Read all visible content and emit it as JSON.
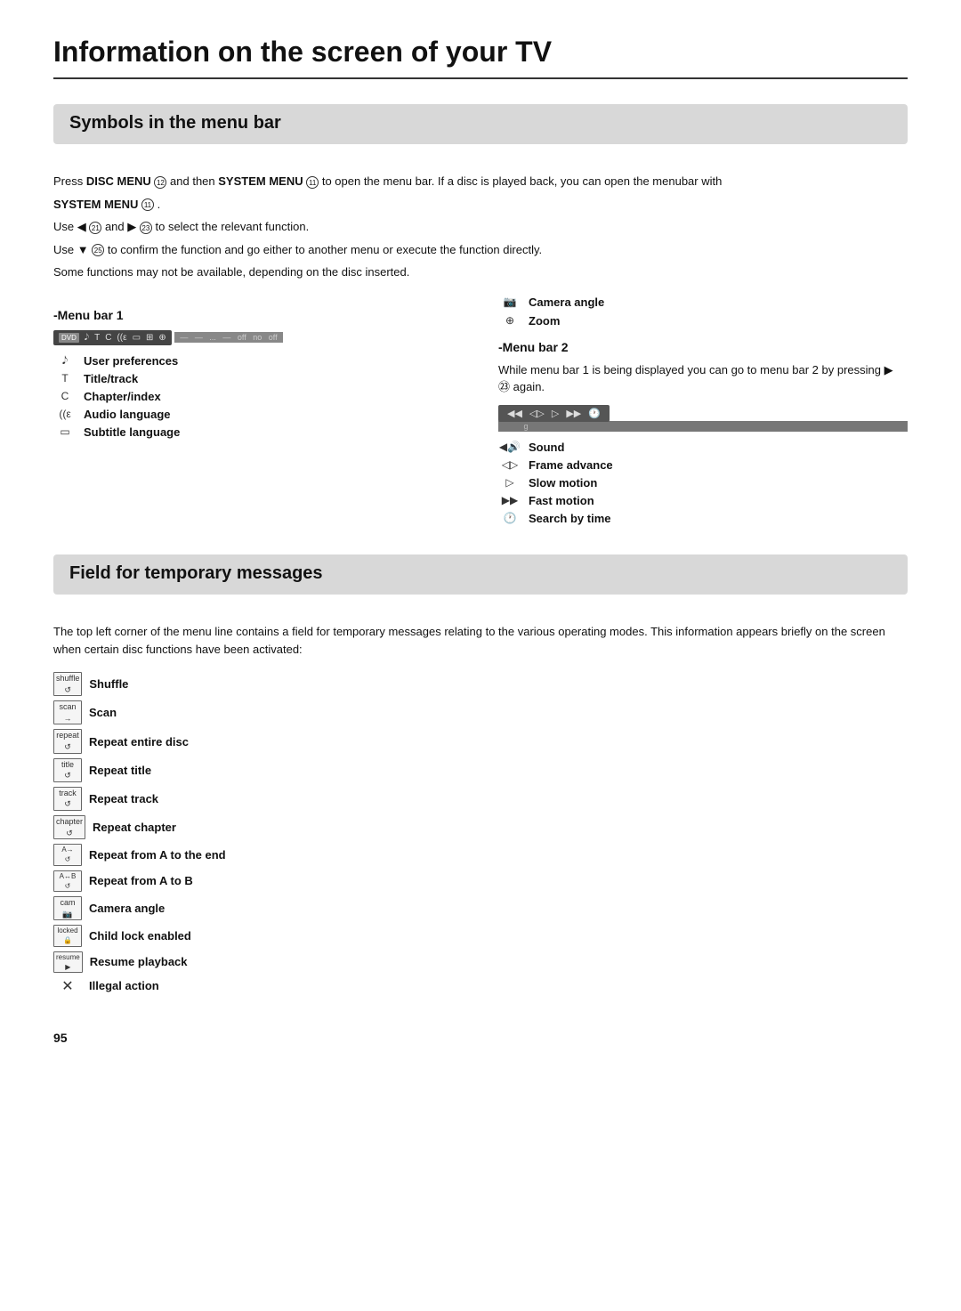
{
  "page": {
    "title": "Information on the screen of your TV",
    "page_number": "95"
  },
  "symbols_section": {
    "heading": "Symbols in the menu bar",
    "intro1": "Press  DISC MENU ⑫ and then  SYSTEM MENU ⑪ to open the menu bar. If a disc is played back, you can open the menubar with  SYSTEM MENU ⑪ .",
    "intro2": "Use ◀ ㉑ and ▶ ㉓ to select the relevant function.",
    "intro3": "Use ▼ ㉕ to confirm the function and go either to another menu or execute the function directly.",
    "intro4": "Some functions may not be available, depending on the disc inserted.",
    "menu_bar_1": {
      "heading": "-Menu bar 1",
      "items": [
        {
          "icon": "𝅘𝅥𝅮",
          "label": "User preferences",
          "sym": "TA"
        },
        {
          "icon": "T",
          "label": "Title/track",
          "sym": "T"
        },
        {
          "icon": "C",
          "label": "Chapter/index",
          "sym": "C"
        },
        {
          "icon": "((ε",
          "label": "Audio language",
          "sym": "audio"
        },
        {
          "icon": "▭",
          "label": "Subtitle language",
          "sym": "sub"
        }
      ]
    },
    "menu_bar_2": {
      "heading": "-Menu bar 2",
      "intro": "While menu bar 1 is being displayed you can go to menu bar 2 by pressing ▶ ㉓ again.",
      "items": [
        {
          "icon": "🔊",
          "label": "Sound",
          "sym": "sound"
        },
        {
          "icon": "◁▷",
          "label": "Frame advance",
          "sym": "frame"
        },
        {
          "icon": "▷",
          "label": "Slow motion",
          "sym": "slow"
        },
        {
          "icon": "▶▶",
          "label": "Fast motion",
          "sym": "fast"
        },
        {
          "icon": "🕐",
          "label": "Search by time",
          "sym": "time"
        }
      ]
    },
    "camera_angle_label": "Camera angle",
    "zoom_label": "Zoom"
  },
  "field_section": {
    "heading": "Field for temporary messages",
    "intro": "The top left corner of the menu line contains a field for temporary messages relating to the various operating modes. This information appears briefly on the screen when certain disc functions have been activated:",
    "items": [
      {
        "badge": "shuffle",
        "label": "Shuffle"
      },
      {
        "badge": "scan",
        "label": "Scan"
      },
      {
        "badge": "repeat",
        "label": "Repeat entire disc"
      },
      {
        "badge": "title",
        "label": "Repeat title"
      },
      {
        "badge": "track",
        "label": "Repeat track"
      },
      {
        "badge": "chapter",
        "label": "Repeat chapter"
      },
      {
        "badge": "A→",
        "label": "Repeat from A to the end"
      },
      {
        "badge": "A↔B",
        "label": "Repeat from A to B"
      },
      {
        "badge": "cam",
        "label": "Camera angle"
      },
      {
        "badge": "locked",
        "label": "Child lock enabled"
      },
      {
        "badge": "resume",
        "label": "Resume playback"
      },
      {
        "badge": "✕",
        "label": "Illegal action"
      }
    ]
  }
}
